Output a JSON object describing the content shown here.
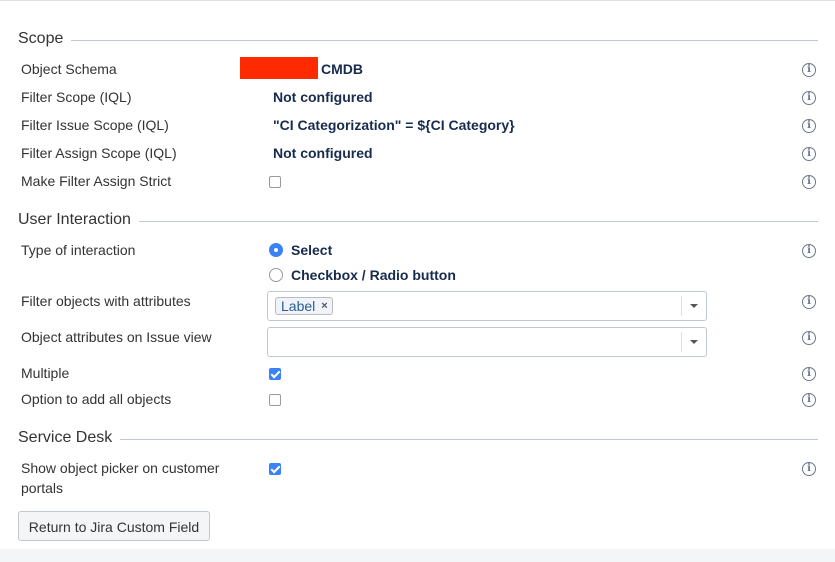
{
  "sections": {
    "scope": "Scope",
    "user_interaction": "User Interaction",
    "service_desk": "Service Desk"
  },
  "scope": {
    "object_schema": {
      "label": "Object Schema",
      "value": "CMDB"
    },
    "filter_scope": {
      "label": "Filter Scope (IQL)",
      "value": "Not configured"
    },
    "filter_issue_scope": {
      "label": "Filter Issue Scope (IQL)",
      "value": "\"CI Categorization\" = ${CI Category}"
    },
    "filter_assign_scope": {
      "label": "Filter Assign Scope (IQL)",
      "value": "Not configured"
    },
    "make_filter_assign_strict": {
      "label": "Make Filter Assign Strict",
      "checked": false
    }
  },
  "user_interaction": {
    "type_of_interaction": {
      "label": "Type of interaction",
      "options": [
        "Select",
        "Checkbox / Radio button"
      ],
      "selected": "Select"
    },
    "filter_objects_with_attributes": {
      "label": "Filter objects with attributes",
      "tags": [
        "Label"
      ]
    },
    "object_attributes_on_issue_view": {
      "label": "Object attributes on Issue view",
      "value": ""
    },
    "multiple": {
      "label": "Multiple",
      "checked": true
    },
    "option_add_all": {
      "label": "Option to add all objects",
      "checked": false
    }
  },
  "service_desk": {
    "show_object_picker": {
      "label": "Show object picker on customer portals",
      "checked": true
    }
  },
  "buttons": {
    "return": "Return to Jira Custom Field"
  },
  "icons": {
    "info": "i",
    "remove_tag": "×"
  },
  "colors": {
    "accent": "#3b82f6",
    "redaction": "#ff2a00"
  }
}
